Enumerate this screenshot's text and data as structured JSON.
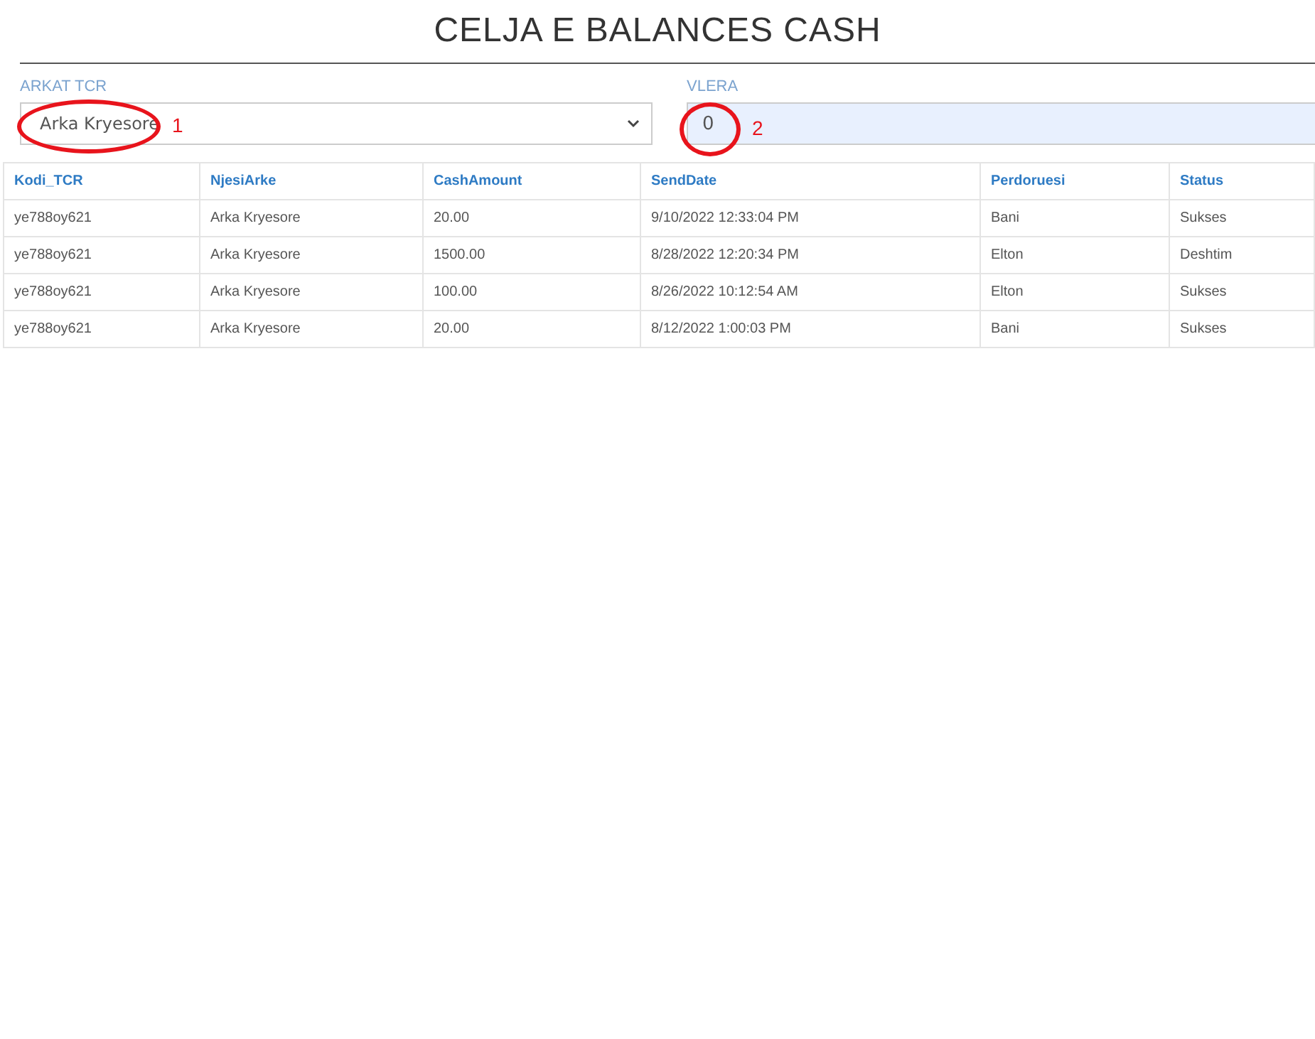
{
  "title": "CELJA E BALANCES CASH",
  "form": {
    "register": {
      "label": "ARKAT TCR",
      "value": "Arka Kryesore",
      "annotation": "1"
    },
    "amount": {
      "label": "VLERA",
      "value": "0",
      "annotation": "2"
    }
  },
  "table": {
    "columns": [
      "Kodi_TCR",
      "NjesiArke",
      "CashAmount",
      "SendDate",
      "Perdoruesi",
      "Status"
    ],
    "rows": [
      [
        "ye788oy621",
        "Arka Kryesore",
        "20.00",
        "9/10/2022 12:33:04 PM",
        "Bani",
        "Sukses"
      ],
      [
        "ye788oy621",
        "Arka Kryesore",
        "1500.00",
        "8/28/2022 12:20:34 PM",
        "Elton",
        "Deshtim"
      ],
      [
        "ye788oy621",
        "Arka Kryesore",
        "100.00",
        "8/26/2022 10:12:54 AM",
        "Elton",
        "Sukses"
      ],
      [
        "ye788oy621",
        "Arka Kryesore",
        "20.00",
        "8/12/2022 1:00:03 PM",
        "Bani",
        "Sukses"
      ]
    ]
  }
}
